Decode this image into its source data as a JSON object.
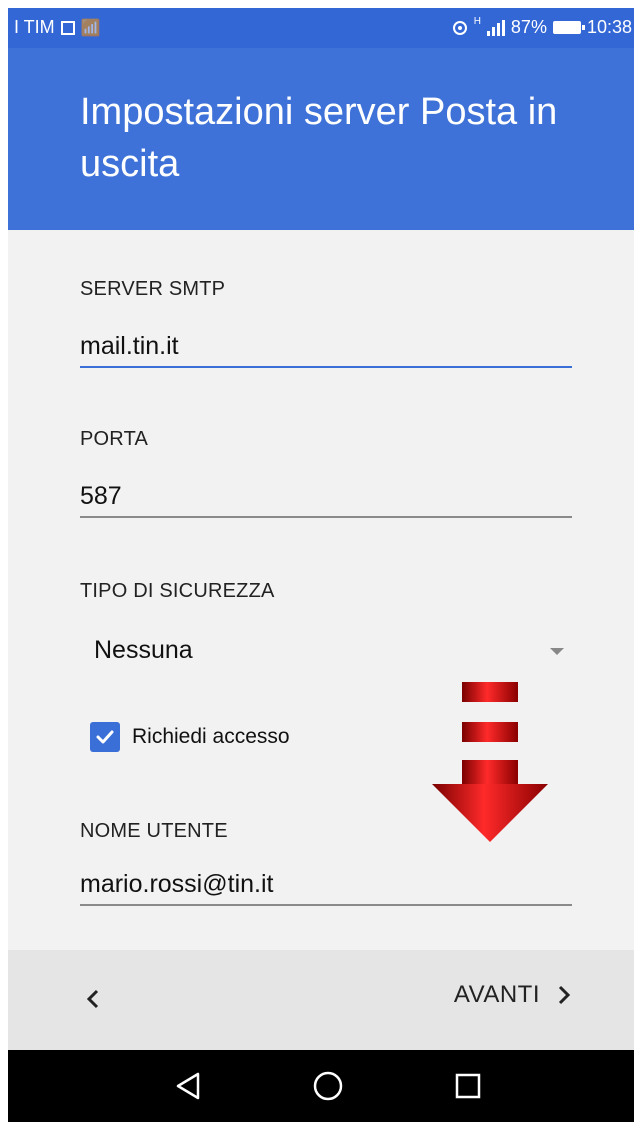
{
  "status_bar": {
    "carrier": "I TIM",
    "network_type": "H",
    "battery": "87%",
    "time": "10:38"
  },
  "header": {
    "title": "Impostazioni server Posta in uscita"
  },
  "form": {
    "smtp": {
      "label": "SERVER SMTP",
      "value": "mail.tin.it"
    },
    "port": {
      "label": "PORTA",
      "value": "587"
    },
    "security": {
      "label": "TIPO DI SICUREZZA",
      "selected": "Nessuna"
    },
    "require_login": {
      "label": "Richiedi accesso",
      "checked": true
    },
    "username": {
      "label": "NOME UTENTE",
      "value": "mario.rossi@tin.it"
    }
  },
  "bottom_bar": {
    "next_label": "AVANTI"
  },
  "colors": {
    "primary": "#3f72d8",
    "status_bar": "#3367d6",
    "accent": "#3b6fd8",
    "arrow": "#c00000"
  },
  "icons": {
    "back": "chevron-left-icon",
    "next": "chevron-right-icon",
    "nav_back": "triangle-back-icon",
    "nav_home": "circle-home-icon",
    "nav_recents": "square-recents-icon"
  }
}
